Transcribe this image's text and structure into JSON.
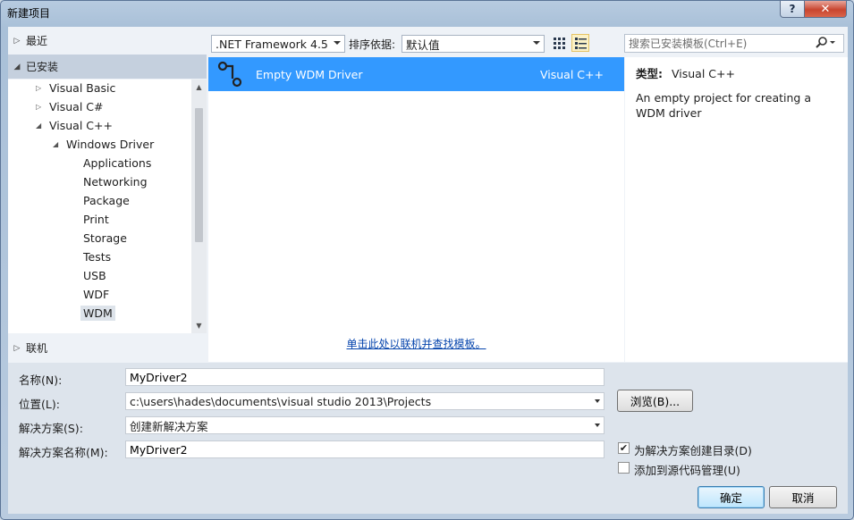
{
  "window": {
    "title": "新建项目",
    "help_label": "?",
    "close_label": "✕"
  },
  "left": {
    "recent": "最近",
    "installed": "已安装",
    "online": "联机",
    "tree": [
      {
        "label": "Visual Basic",
        "expand": "▷"
      },
      {
        "label": "Visual C#",
        "expand": "▷"
      },
      {
        "label": "Visual C++",
        "expand": "◢"
      },
      {
        "label": "Windows Driver",
        "expand": "◢"
      },
      {
        "label": "Applications",
        "expand": ""
      },
      {
        "label": "Networking",
        "expand": ""
      },
      {
        "label": "Package",
        "expand": ""
      },
      {
        "label": "Print",
        "expand": ""
      },
      {
        "label": "Storage",
        "expand": ""
      },
      {
        "label": "Tests",
        "expand": ""
      },
      {
        "label": "USB",
        "expand": ""
      },
      {
        "label": "WDF",
        "expand": ""
      },
      {
        "label": "WDM",
        "expand": ""
      }
    ]
  },
  "toolbar": {
    "framework": ".NET Framework 4.5",
    "sort_label": "排序依据:",
    "sort_value": "默认值",
    "search_placeholder": "搜索已安装模板(Ctrl+E)"
  },
  "templates": [
    {
      "name": "Empty WDM Driver",
      "language": "Visual C++"
    }
  ],
  "online_link": "单击此处以联机并查找模板。",
  "details": {
    "type_label": "类型:",
    "type_value": "Visual C++",
    "description": "An empty project for creating a WDM driver"
  },
  "form": {
    "name_label": "名称(N):",
    "name_value": "MyDriver2",
    "location_label": "位置(L):",
    "location_value": "c:\\users\\hades\\documents\\visual studio 2013\\Projects",
    "solution_label": "解决方案(S):",
    "solution_value": "创建新解决方案",
    "solution_name_label": "解决方案名称(M):",
    "solution_name_value": "MyDriver2",
    "browse_label": "浏览(B)...",
    "create_dir_label": "为解决方案创建目录(D)",
    "create_dir_checked": "✔",
    "source_control_label": "添加到源代码管理(U)",
    "ok_label": "确定",
    "cancel_label": "取消"
  },
  "colors": {
    "selection": "#3399ff",
    "link": "#0645ad",
    "close_button": "#c8452f"
  }
}
